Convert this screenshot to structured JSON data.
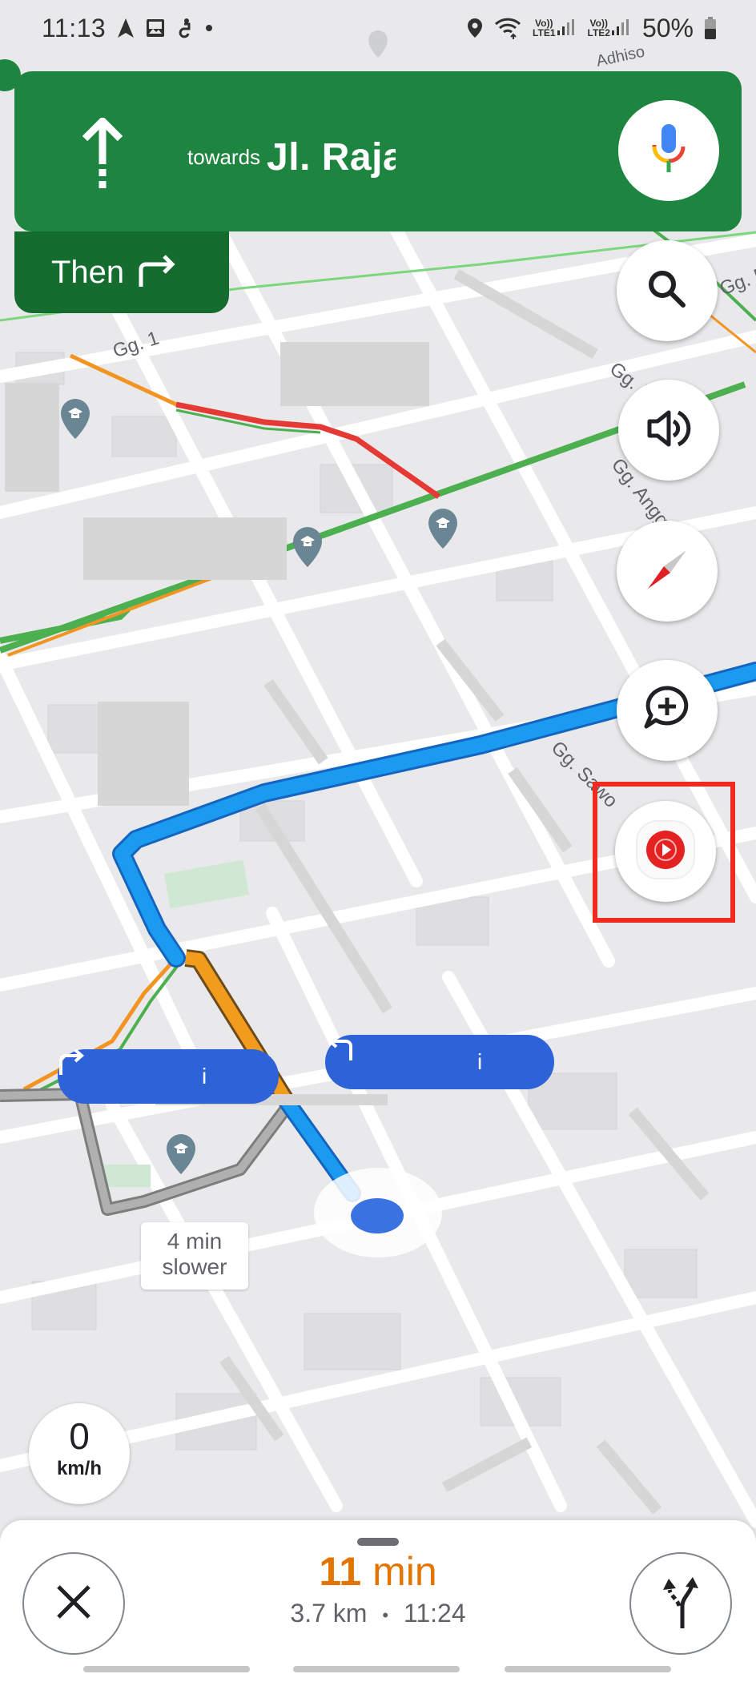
{
  "status_bar": {
    "time": "11:13",
    "left_icons": [
      "navigation-icon",
      "gallery-icon",
      "accessibility-icon",
      "dot-icon"
    ],
    "right_icons": [
      "location-icon",
      "wifi-icon",
      "lte1-signal-icon",
      "lte2-signal-icon",
      "battery-icon"
    ],
    "sim1_label_top": "Vo))",
    "sim1_label_bottom": "LTE1",
    "sim2_label_top": "Vo))",
    "sim2_label_bottom": "LTE2",
    "battery": "50%"
  },
  "navigation": {
    "maneuver_icon": "straight-arrow-icon",
    "towards_label": "towards",
    "road_name": "Jl. Raja",
    "then_label": "Then",
    "then_icon": "turn-right-icon",
    "header_color": "#1e8540",
    "then_color": "#146c2e"
  },
  "fabs": [
    {
      "name": "voice-search",
      "icon": "microphone-icon"
    },
    {
      "name": "search",
      "icon": "search-icon"
    },
    {
      "name": "sound",
      "icon": "speaker-icon"
    },
    {
      "name": "compass",
      "icon": "compass-icon"
    },
    {
      "name": "report",
      "icon": "add-report-icon"
    },
    {
      "name": "youtube-music",
      "icon": "youtube-music-icon",
      "highlighted": true
    }
  ],
  "map": {
    "labels": [
      "Gg. 1",
      "Gg. Ikhlas",
      "Gg. Anggrek",
      "Gg. Me",
      "Gg. Sawo",
      "Adhiso"
    ],
    "route_color": "#1a9bf0",
    "traffic_heavy": "#e53935",
    "traffic_moderate": "#f29422",
    "traffic_free": "#4caf50",
    "alt_route_color": "#9e9e9e",
    "callouts": [
      {
        "icon": "turn-right-icon",
        "label": "i"
      },
      {
        "icon": "turn-left-icon",
        "label": "i"
      }
    ],
    "alt_route_tag": {
      "line1": "4 min",
      "line2": "slower"
    }
  },
  "speedometer": {
    "value": "0",
    "unit": "km/h"
  },
  "trip": {
    "eta_number": "11",
    "eta_unit": "min",
    "distance": "3.7 km",
    "separator": "•",
    "arrival_time": "11:24",
    "eta_color": "#e37400"
  },
  "bottom_actions": {
    "close_icon": "close-icon",
    "routes_icon": "alternate-routes-icon"
  }
}
